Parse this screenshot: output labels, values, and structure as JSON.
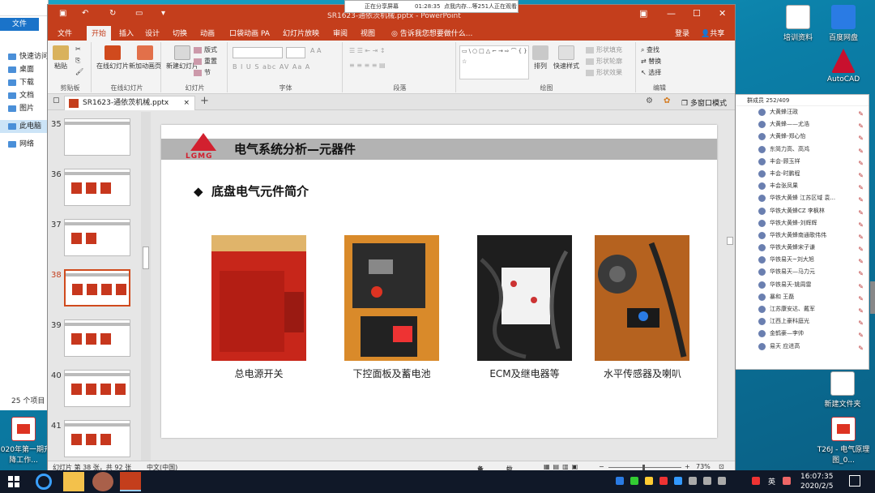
{
  "desktop": {
    "icons_right": [
      {
        "label": "培训资料",
        "icon": "file-icon"
      },
      {
        "label": "百度网盘",
        "icon": "cloud-icon"
      },
      {
        "label": "AutoCAD",
        "icon": "autocad-icon"
      },
      {
        "label": "新建文件夹",
        "icon": "file-icon"
      },
      {
        "label": "T26J - 电气原理图_0...",
        "icon": "pdf-icon"
      }
    ],
    "icons_left": [
      {
        "label": "2020年第一期升降工作...",
        "icon": "pdf-icon"
      }
    ]
  },
  "explorer": {
    "file_tab": "文件",
    "nav": [
      "快速访问",
      "桌面",
      "下载",
      "文档",
      "图片",
      "此电脑",
      "网络"
    ],
    "selected_index": 5,
    "item_count": "25 个项目"
  },
  "share_banner": {
    "sharing": "正在分享屏幕",
    "timer": "01:28:35",
    "viewers": "点我内存...等251人正在观看"
  },
  "ppt": {
    "window_title": "SR1623-通依茨机械.pptx - PowerPoint",
    "menu_tabs": [
      "文件",
      "开始",
      "插入",
      "设计",
      "切换",
      "动画",
      "口袋动画 PA",
      "幻灯片放映",
      "审阅",
      "视图"
    ],
    "active_tab": "开始",
    "tell_me": "告诉我您想要做什么...",
    "login": "登录",
    "share": "共享",
    "ribbon": {
      "clipboard": {
        "label": "剪贴板",
        "paste": "粘贴"
      },
      "new_slide": {
        "label": "在线幻灯片",
        "online": "在线幻灯片",
        "new_anim": "新加动画页"
      },
      "slides": {
        "label": "幻灯片",
        "new": "新建幻灯片",
        "layout": "版式",
        "reset": "重置",
        "section": "节"
      },
      "font": {
        "label": "字体",
        "styles": "B I U S abc AV Aa A"
      },
      "paragraph": {
        "label": "段落"
      },
      "drawing": {
        "label": "绘图",
        "arrange": "排列",
        "quick_styles": "快速样式",
        "fill": "形状填充",
        "outline": "形状轮廓",
        "effects": "形状效果",
        "shapes_preview": "▭\\○□△⌐→⇨⌒{}☆"
      },
      "editing": {
        "label": "编辑",
        "find": "查找",
        "replace": "替换",
        "select": "选择"
      }
    },
    "doc_tab": "SR1623-通依茨机械.pptx",
    "multiwindow": "多窗口模式",
    "thumbnails": [
      {
        "num": "35",
        "selected": false,
        "pics": 0
      },
      {
        "num": "36",
        "selected": false,
        "pics": 3
      },
      {
        "num": "37",
        "selected": false,
        "pics": 2
      },
      {
        "num": "38",
        "selected": true,
        "pics": 4
      },
      {
        "num": "39",
        "selected": false,
        "pics": 3
      },
      {
        "num": "40",
        "selected": false,
        "pics": 4
      },
      {
        "num": "41",
        "selected": false,
        "pics": 3
      }
    ],
    "slide": {
      "logo_text": "LGMG",
      "title": "电气系统分析—元器件",
      "subheading": "底盘电气元件简介",
      "bullet": "◆",
      "photos": [
        {
          "caption": "总电源开关",
          "color": "#c7261a"
        },
        {
          "caption": "下控面板及蓄电池",
          "color": "#d98a2a"
        },
        {
          "caption": "ECM及继电器等",
          "color": "#1e1e1e"
        },
        {
          "caption": "水平传感器及喇叭",
          "color": "#b5621f"
        }
      ]
    },
    "status": {
      "slide_info": "幻灯片 第 38 张，共 92 张",
      "language": "中文(中国)",
      "notes": "备注",
      "comments": "批注",
      "zoom": "73%"
    }
  },
  "chat": {
    "header": "群成员 252/409",
    "members": [
      "大黄蜂汪政",
      "大黄蜂——尤浩",
      "大黄蜂-郑心怡",
      "东简力高、高鸿",
      "丰会-顾玉祥",
      "丰会-时鹏程",
      "丰会张凤果",
      "华铁大黄蜂 江苏区域 袁...",
      "华铁大黄蜂CZ 李枫林",
      "华铁大黄蜂-刘辉辉",
      "华铁大黄蜂南通歌伟伟",
      "华铁大黄蜂宋子谦",
      "华铁易天~刘大旭",
      "华铁易天—马力元",
      "华铁易天-姚周雷",
      "暴和 王磊",
      "江苏康安达、戴军",
      "江西上豪科庭光",
      "金鹤豪—李帅",
      "易天 应进高"
    ]
  },
  "taskbar": {
    "time": "16:07:35",
    "date": "2020/2/5",
    "lang": "英"
  }
}
